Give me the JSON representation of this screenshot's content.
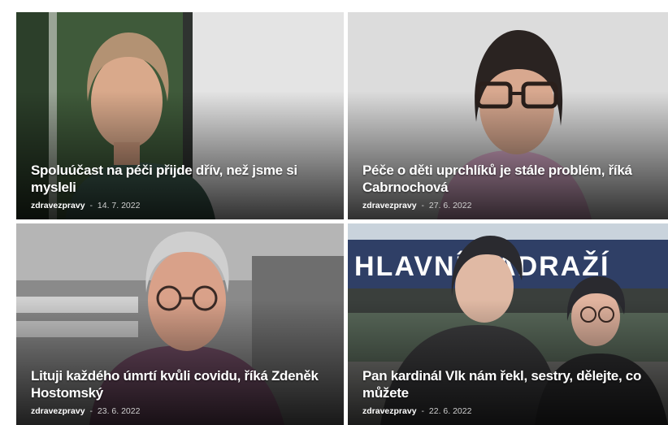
{
  "articles": [
    {
      "title": "Spoluúčast na péči přijde dřív, než jsme si mysleli",
      "author": "zdravezpravy",
      "separator": "-",
      "date": "14. 7. 2022"
    },
    {
      "title": "Péče o děti uprchlíků je stále problém, říká Cabrnochová",
      "author": "zdravezpravy",
      "separator": "-",
      "date": "27. 6. 2022"
    },
    {
      "title": "Lituji každého úmrtí kvůli covidu, říká Zdeněk Hostomský",
      "author": "zdravezpravy",
      "separator": "-",
      "date": "23. 6. 2022"
    },
    {
      "title": "Pan kardinál Vlk nám řekl, sestry, dělejte, co můžete",
      "author": "zdravezpravy",
      "separator": "-",
      "date": "22. 6. 2022",
      "photo_sign_text": "HLAVNÍ NÁDRAŽÍ"
    }
  ]
}
